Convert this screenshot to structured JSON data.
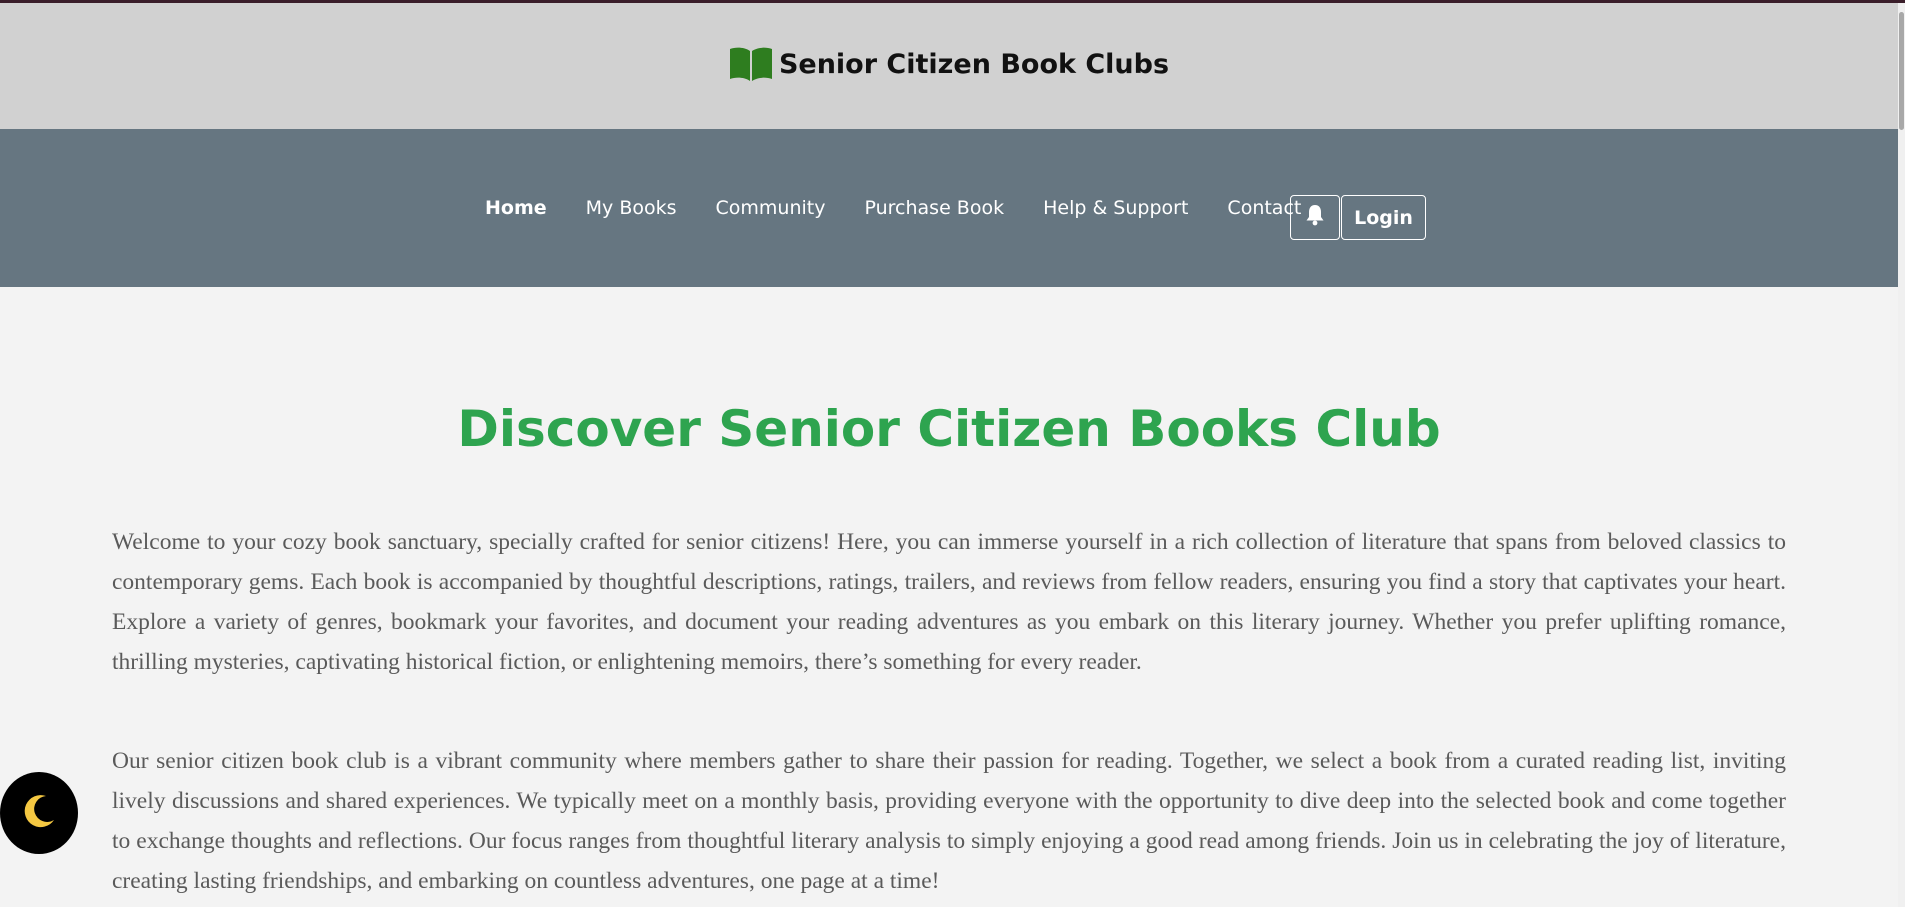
{
  "brand": {
    "icon": "open-book-icon",
    "title": "Senior Citizen Book Clubs",
    "icon_color": "#2e7d1f"
  },
  "nav": {
    "items": [
      {
        "label": "Home",
        "active": true
      },
      {
        "label": "My Books"
      },
      {
        "label": "Community"
      },
      {
        "label": "Purchase Book"
      },
      {
        "label": "Help & Support"
      },
      {
        "label": "Contact"
      }
    ],
    "bell_icon": "bell-icon",
    "login_label": "Login"
  },
  "main": {
    "title": "Discover Senior Citizen Books Club",
    "paragraph1": "Welcome to your cozy book sanctuary, specially crafted for senior citizens! Here, you can immerse yourself in a rich collection of literature that spans from beloved classics to contemporary gems. Each book is accompanied by thoughtful descriptions, ratings, trailers, and reviews from fellow readers, ensuring you find a story that captivates your heart. Explore a variety of genres, bookmark your favorites, and document your reading adventures as you embark on this literary journey. Whether you prefer uplifting romance, thrilling mysteries, captivating historical fiction, or enlightening memoirs, there’s something for every reader.",
    "paragraph2": "Our senior citizen book club is a vibrant community where members gather to share their passion for reading. Together, we select a book from a curated reading list, inviting lively discussions and shared experiences. We typically meet on a monthly basis, providing everyone with the opportunity to dive deep into the selected book and come together to exchange thoughts and reflections. Our focus ranges from thoughtful literary analysis to simply enjoying a good read among friends. Join us in celebrating the joy of literature, creating lasting friendships, and embarking on countless adventures, one page at a time!"
  },
  "theme_toggle": {
    "icon": "crescent-moon-icon",
    "glyph": "🌙"
  },
  "colors": {
    "brand_bar": "#d1d1d1",
    "nav_bar": "#667681",
    "title_green": "#2ea44f",
    "page_bg": "#f3f3f3"
  }
}
